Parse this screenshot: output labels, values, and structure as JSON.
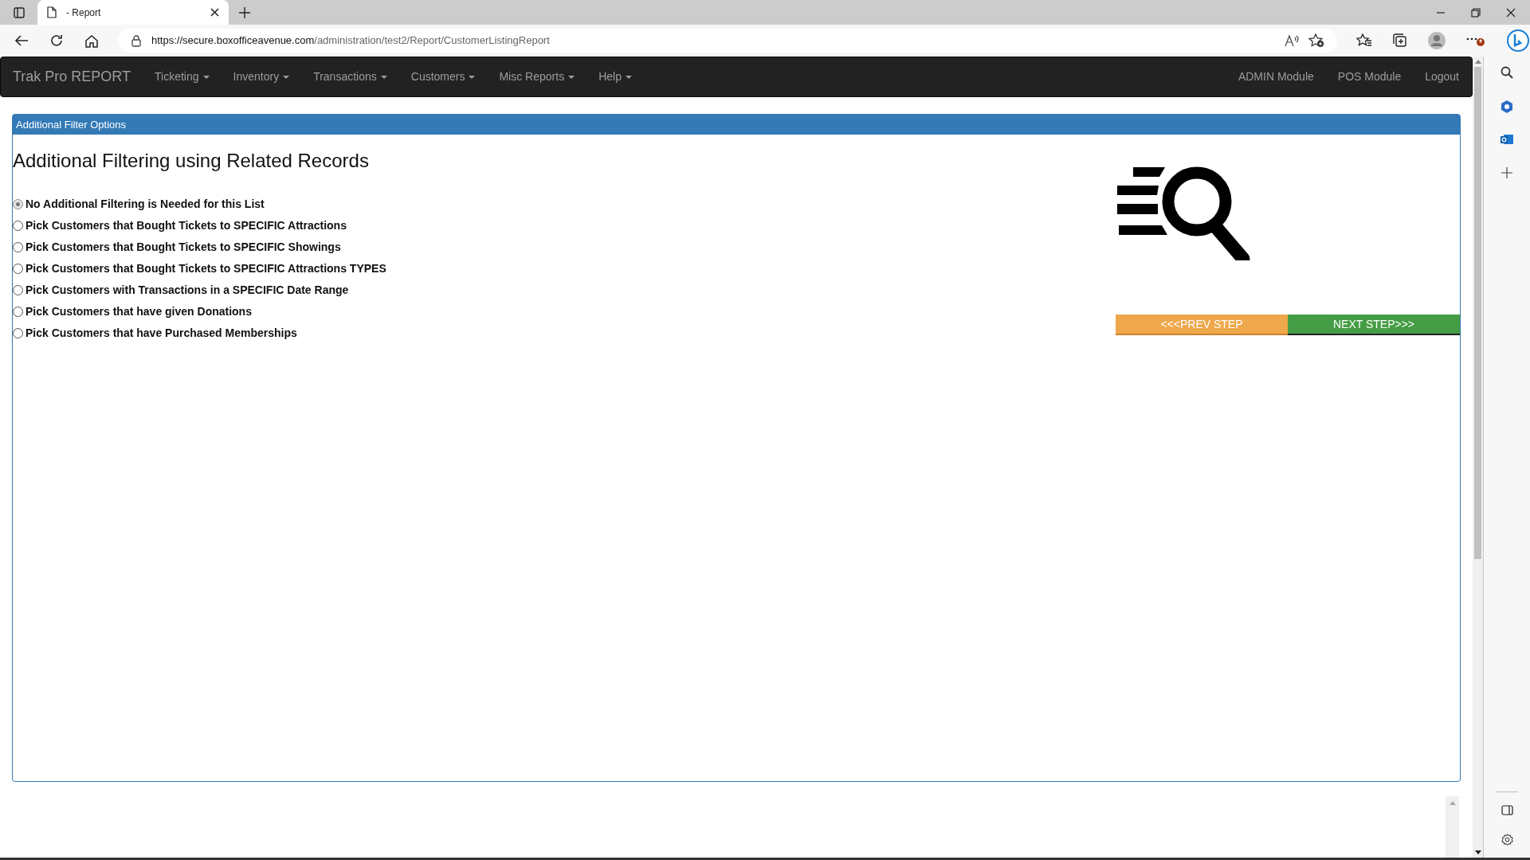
{
  "browser": {
    "tab_title": "- Report",
    "url_host": "https://secure.boxofficeavenue.com",
    "url_path": "/administration/test2/Report/CustomerListingReport"
  },
  "navbar": {
    "brand": "Trak Pro REPORT",
    "menus": [
      {
        "label": "Ticketing"
      },
      {
        "label": "Inventory"
      },
      {
        "label": "Transactions"
      },
      {
        "label": "Customers"
      },
      {
        "label": "Misc Reports"
      },
      {
        "label": "Help"
      }
    ],
    "links": [
      "ADMIN Module",
      "POS Module",
      "Logout"
    ]
  },
  "panel": {
    "title": "Additional Filter Options",
    "heading": "Additional Filtering using Related Records",
    "options": [
      {
        "label": "No Additional Filtering is Needed for this List",
        "selected": true
      },
      {
        "label": "Pick Customers that Bought Tickets to SPECIFIC Attractions",
        "selected": false
      },
      {
        "label": "Pick Customers that Bought Tickets to SPECIFIC Showings",
        "selected": false
      },
      {
        "label": "Pick Customers that Bought Tickets to SPECIFIC Attractions TYPES",
        "selected": false
      },
      {
        "label": "Pick Customers with Transactions in a SPECIFIC Date Range",
        "selected": false
      },
      {
        "label": "Pick Customers that have given Donations",
        "selected": false
      },
      {
        "label": "Pick Customers that have Purchased Memberships",
        "selected": false
      }
    ],
    "buttons": [
      {
        "kind": "prev",
        "label": "<<<PREV STEP"
      },
      {
        "kind": "next",
        "label": "NEXT STEP>>>"
      }
    ]
  }
}
